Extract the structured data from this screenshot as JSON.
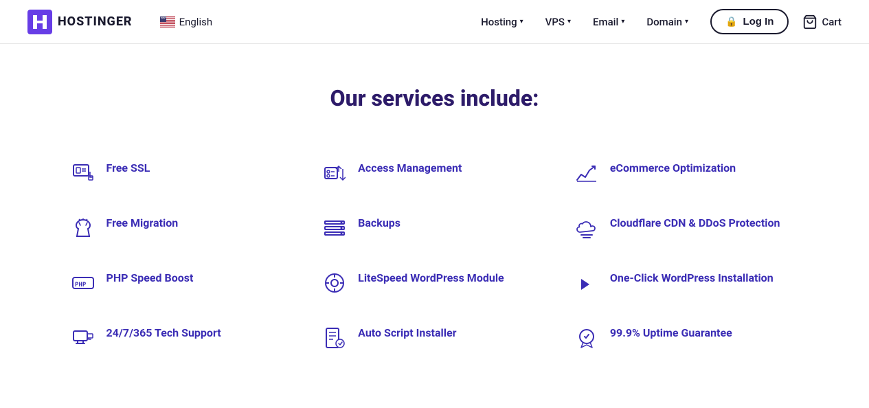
{
  "header": {
    "logo_text": "HOSTINGER",
    "lang": {
      "text": "English"
    },
    "nav": [
      {
        "label": "Hosting",
        "id": "hosting"
      },
      {
        "label": "VPS",
        "id": "vps"
      },
      {
        "label": "Email",
        "id": "email"
      },
      {
        "label": "Domain",
        "id": "domain"
      }
    ],
    "login_label": "Log In",
    "cart_label": "Cart"
  },
  "main": {
    "section_title": "Our services include:",
    "services": [
      {
        "id": "free-ssl",
        "label": "Free SSL",
        "icon": "ssl"
      },
      {
        "id": "access-management",
        "label": "Access Management",
        "icon": "access"
      },
      {
        "id": "ecommerce",
        "label": "eCommerce Optimization",
        "icon": "ecommerce"
      },
      {
        "id": "free-migration",
        "label": "Free Migration",
        "icon": "migration"
      },
      {
        "id": "backups",
        "label": "Backups",
        "icon": "backups"
      },
      {
        "id": "cloudflare",
        "label": "Cloudflare CDN & DDoS Protection",
        "icon": "cloudflare"
      },
      {
        "id": "php-speed",
        "label": "PHP Speed Boost",
        "icon": "php"
      },
      {
        "id": "litespeed",
        "label": "LiteSpeed WordPress Module",
        "icon": "litespeed"
      },
      {
        "id": "wordpress-install",
        "label": "One-Click WordPress Installation",
        "icon": "wordpress"
      },
      {
        "id": "tech-support",
        "label": "24/7/365 Tech Support",
        "icon": "support"
      },
      {
        "id": "auto-script",
        "label": "Auto Script Installer",
        "icon": "autoscript"
      },
      {
        "id": "uptime",
        "label": "99.9% Uptime Guarantee",
        "icon": "uptime"
      }
    ]
  },
  "colors": {
    "brand_purple": "#3b2db5",
    "dark": "#1a1a2e"
  }
}
